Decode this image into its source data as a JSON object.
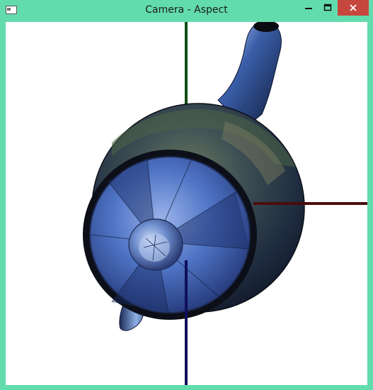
{
  "window": {
    "title": "Camera - Aspect",
    "accent_color": "#63dcad",
    "close_color": "#c7463d"
  },
  "titlebar": {
    "app_icon": "window-icon",
    "minimize_icon": "minimize-icon",
    "maximize_icon": "maximize-icon",
    "close_icon": "close-icon"
  },
  "scene": {
    "object": "teapot-icon",
    "axis_colors": {
      "x": "#4a0d0d",
      "y": "#0f4f12",
      "z": "#0e0f5a"
    },
    "background": "#ffffff"
  }
}
